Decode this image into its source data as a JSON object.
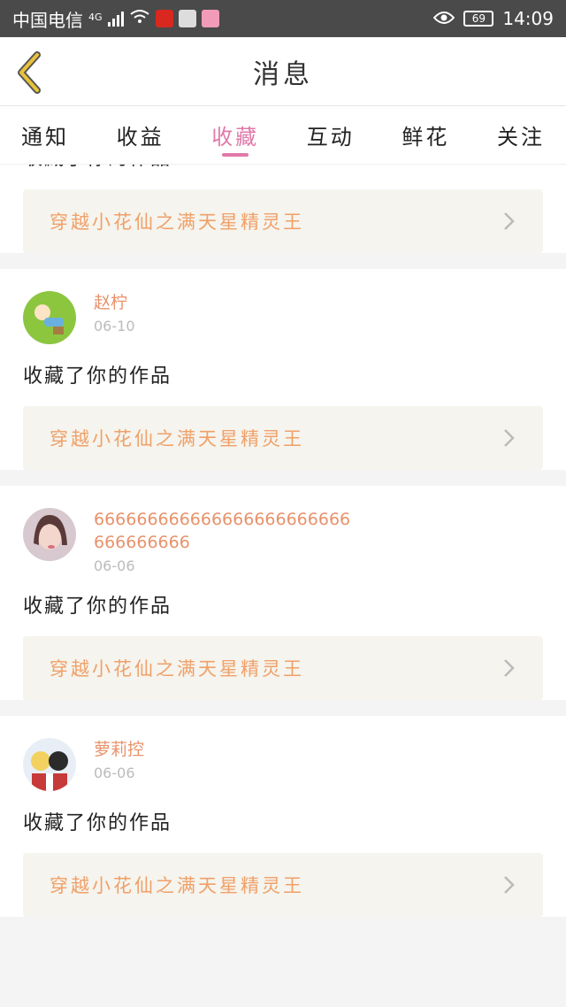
{
  "status": {
    "carrier": "中国电信",
    "network": "4G",
    "battery": "69",
    "time": "14:09"
  },
  "header": {
    "title": "消息"
  },
  "tabs": [
    {
      "label": "通知",
      "active": false
    },
    {
      "label": "收益",
      "active": false
    },
    {
      "label": "收藏",
      "active": true
    },
    {
      "label": "互动",
      "active": false
    },
    {
      "label": "鲜花",
      "active": false
    },
    {
      "label": "关注",
      "active": false
    }
  ],
  "feed": {
    "items": [
      {
        "action": "收藏了你的作品",
        "work": "穿越小花仙之满天星精灵王"
      },
      {
        "name": "赵柠",
        "date": "06-10",
        "action": "收藏了你的作品",
        "work": "穿越小花仙之满天星精灵王"
      },
      {
        "name": "666666666666666666666666666666666",
        "date": "06-06",
        "action": "收藏了你的作品",
        "work": "穿越小花仙之满天星精灵王"
      },
      {
        "name": "萝莉控",
        "date": "06-06",
        "action": "收藏了你的作品",
        "work": "穿越小花仙之满天星精灵王"
      }
    ]
  },
  "colors": {
    "accent": "#e07aa8",
    "username": "#e8926b",
    "work_title": "#f0a068",
    "back_arrow": "#e8c23a"
  }
}
